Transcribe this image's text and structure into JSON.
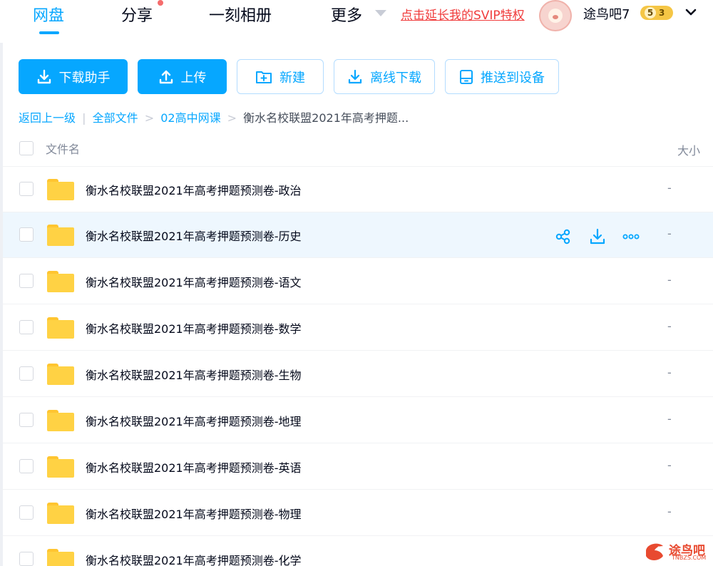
{
  "nav": {
    "items": [
      {
        "label": "网盘",
        "active": true
      },
      {
        "label": "分享",
        "has_dot": true
      },
      {
        "label": "一刻相册"
      },
      {
        "label": "更多"
      }
    ],
    "svip_link": "点击延长我的SVIP特权",
    "username": "途鸟吧7",
    "badge_level": "5",
    "badge_count": "3",
    "accent_color": "#06a7ff",
    "alert_color": "#f03c3c"
  },
  "toolbar": {
    "download_helper": "下载助手",
    "upload": "上传",
    "new": "新建",
    "offline_download": "离线下载",
    "push_to_device": "推送到设备"
  },
  "breadcrumb": {
    "back": "返回上一级",
    "divider": "|",
    "all_files": "全部文件",
    "sep": ">",
    "folder1": "02高中网课",
    "current": "衡水名校联盟2021年高考押题..."
  },
  "table": {
    "col_name": "文件名",
    "col_size": "大小",
    "rows": [
      {
        "name": "衡水名校联盟2021年高考押题预测卷-政治",
        "size": "-"
      },
      {
        "name": "衡水名校联盟2021年高考押题预测卷-历史",
        "size": "-",
        "hovered": true
      },
      {
        "name": "衡水名校联盟2021年高考押题预测卷-语文",
        "size": "-"
      },
      {
        "name": "衡水名校联盟2021年高考押题预测卷-数学",
        "size": "-"
      },
      {
        "name": "衡水名校联盟2021年高考押题预测卷-生物",
        "size": "-"
      },
      {
        "name": "衡水名校联盟2021年高考押题预测卷-地理",
        "size": "-"
      },
      {
        "name": "衡水名校联盟2021年高考押题预测卷-英语",
        "size": "-"
      },
      {
        "name": "衡水名校联盟2021年高考押题预测卷-物理",
        "size": "-"
      },
      {
        "name": "衡水名校联盟2021年高考押题预测卷-化学",
        "size": ""
      }
    ]
  },
  "watermark": {
    "text": "途鸟吧",
    "sub": "TNBZS.COM"
  }
}
